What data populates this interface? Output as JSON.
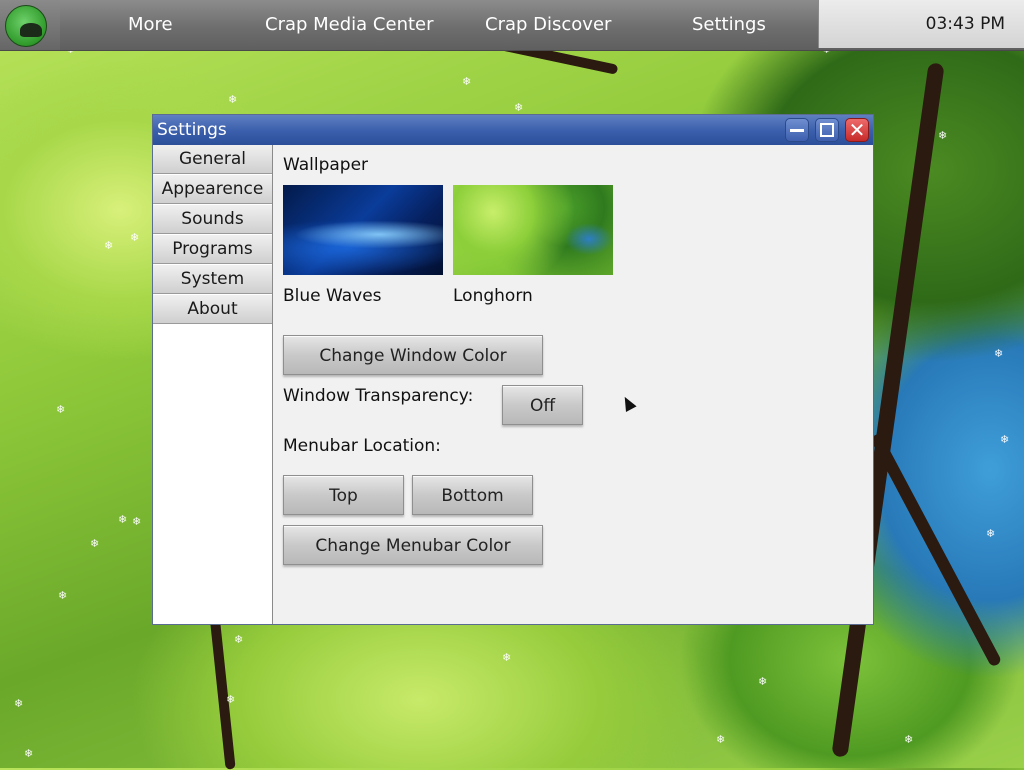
{
  "menubar": {
    "logo_icon": "hat-logo-icon",
    "items": [
      "More",
      "Crap Media Center",
      "Crap Discover",
      "Settings"
    ],
    "clock": "03:43 PM"
  },
  "window": {
    "title": "Settings",
    "controls": [
      "minimize-icon",
      "maximize-icon",
      "close-icon"
    ],
    "sidebar": [
      "General",
      "Appearence",
      "Sounds",
      "Programs",
      "System",
      "About"
    ],
    "wallpaper": {
      "heading": "Wallpaper",
      "options": [
        {
          "label": "Blue Waves"
        },
        {
          "label": "Longhorn"
        }
      ]
    },
    "change_window_color": "Change Window Color",
    "transparency": {
      "label": "Window Transparency:",
      "value": "Off"
    },
    "menubar_location": {
      "label": "Menubar Location:",
      "top": "Top",
      "bottom": "Bottom"
    },
    "change_menubar_color": "Change Menubar Color"
  },
  "colors": {
    "titlebar": "#3a5eab",
    "close": "#c62a2a",
    "menubar": "#6e6e6e"
  }
}
